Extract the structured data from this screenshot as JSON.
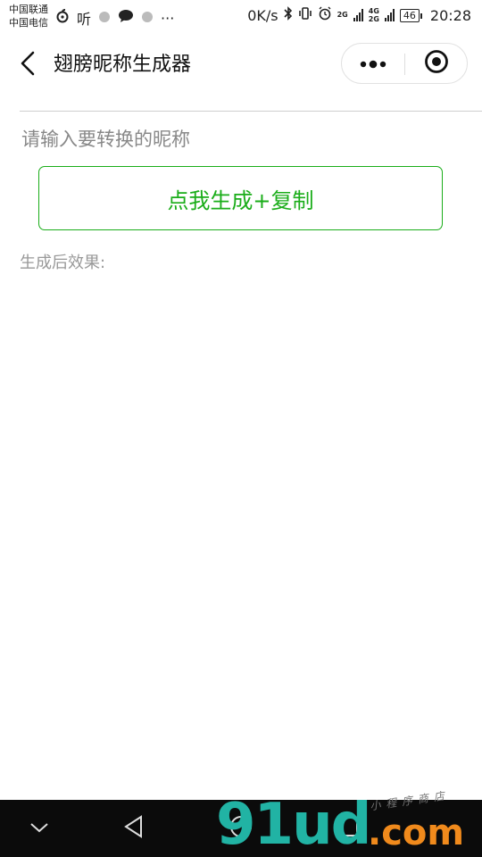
{
  "status_bar": {
    "carrier_1": "中国联通",
    "carrier_2": "中国电信",
    "listen_app": "听",
    "more": "···",
    "net_speed": "0K/s",
    "net_2g": "2G",
    "net_4g": "4G",
    "net_2g_b": "2G",
    "battery": "46",
    "time": "20:28"
  },
  "navbar": {
    "title": "翅膀昵称生成器",
    "back_icon": "chevron-left-icon",
    "more_icon": "more-dots-icon",
    "close_icon": "target-close-icon"
  },
  "form": {
    "input_placeholder": "请输入要转换的昵称",
    "input_value": "",
    "generate_button": "点我生成+复制",
    "result_label": "生成后效果:"
  },
  "watermark": {
    "main": "91ud",
    "dot_com": ".com",
    "sub": "小程序商店"
  },
  "colors": {
    "accent": "#1aad19",
    "watermark_teal": "#21b3a4",
    "watermark_orange": "#f08a1c"
  }
}
